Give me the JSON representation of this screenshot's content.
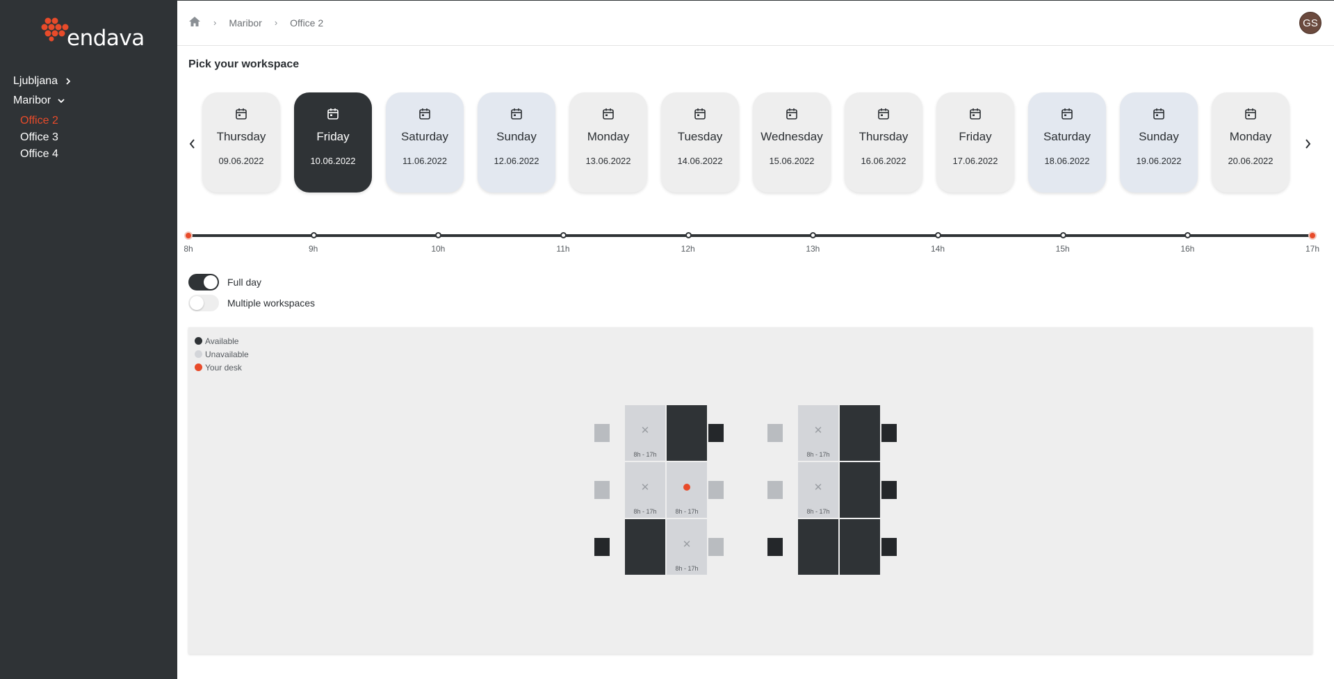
{
  "brand": {
    "name": "endava",
    "accent": "#e84b2a",
    "dark": "#2f3336"
  },
  "sidebar": {
    "cities": [
      {
        "label": "Ljubljana",
        "expanded": false,
        "offices": []
      },
      {
        "label": "Maribor",
        "expanded": true,
        "offices": [
          {
            "label": "Office 2",
            "active": true
          },
          {
            "label": "Office 3",
            "active": false
          },
          {
            "label": "Office 4",
            "active": false
          }
        ]
      }
    ]
  },
  "header": {
    "breadcrumb": [
      "Maribor",
      "Office 2"
    ],
    "home_icon": "home-icon",
    "avatar_initials": "GS"
  },
  "page": {
    "title": "Pick your workspace"
  },
  "days": [
    {
      "name": "Thursday",
      "date": "09.06.2022",
      "state": "weekday"
    },
    {
      "name": "Friday",
      "date": "10.06.2022",
      "state": "selected"
    },
    {
      "name": "Saturday",
      "date": "11.06.2022",
      "state": "weekend"
    },
    {
      "name": "Sunday",
      "date": "12.06.2022",
      "state": "weekend"
    },
    {
      "name": "Monday",
      "date": "13.06.2022",
      "state": "weekday"
    },
    {
      "name": "Tuesday",
      "date": "14.06.2022",
      "state": "weekday"
    },
    {
      "name": "Wednesday",
      "date": "15.06.2022",
      "state": "weekday"
    },
    {
      "name": "Thursday",
      "date": "16.06.2022",
      "state": "weekday"
    },
    {
      "name": "Friday",
      "date": "17.06.2022",
      "state": "weekday"
    },
    {
      "name": "Saturday",
      "date": "18.06.2022",
      "state": "weekend"
    },
    {
      "name": "Sunday",
      "date": "19.06.2022",
      "state": "weekend"
    },
    {
      "name": "Monday",
      "date": "20.06.2022",
      "state": "weekday"
    }
  ],
  "timeline": {
    "ticks": [
      "8h",
      "9h",
      "10h",
      "11h",
      "12h",
      "13h",
      "14h",
      "15h",
      "16h",
      "17h"
    ],
    "selected_start": "8h",
    "selected_end": "17h"
  },
  "toggles": {
    "full_day": {
      "label": "Full day",
      "on": true
    },
    "multiple": {
      "label": "Multiple workspaces",
      "on": false
    }
  },
  "legend": [
    {
      "label": "Available",
      "color": "#2f3336"
    },
    {
      "label": "Unavailable",
      "color": "#d3d5d9"
    },
    {
      "label": "Your desk",
      "color": "#e84b2a"
    }
  ],
  "desk_groups": [
    {
      "desks": [
        {
          "status": "unavailable",
          "hours": "8h - 17h"
        },
        {
          "status": "available",
          "hours": ""
        },
        {
          "status": "unavailable",
          "hours": "8h - 17h"
        },
        {
          "status": "mine",
          "hours": "8h - 17h"
        },
        {
          "status": "available",
          "hours": ""
        },
        {
          "status": "unavailable",
          "hours": "8h - 17h"
        }
      ]
    },
    {
      "desks": [
        {
          "status": "unavailable",
          "hours": "8h - 17h"
        },
        {
          "status": "available",
          "hours": ""
        },
        {
          "status": "unavailable",
          "hours": "8h - 17h"
        },
        {
          "status": "available",
          "hours": ""
        },
        {
          "status": "available",
          "hours": ""
        },
        {
          "status": "available",
          "hours": ""
        }
      ]
    }
  ]
}
